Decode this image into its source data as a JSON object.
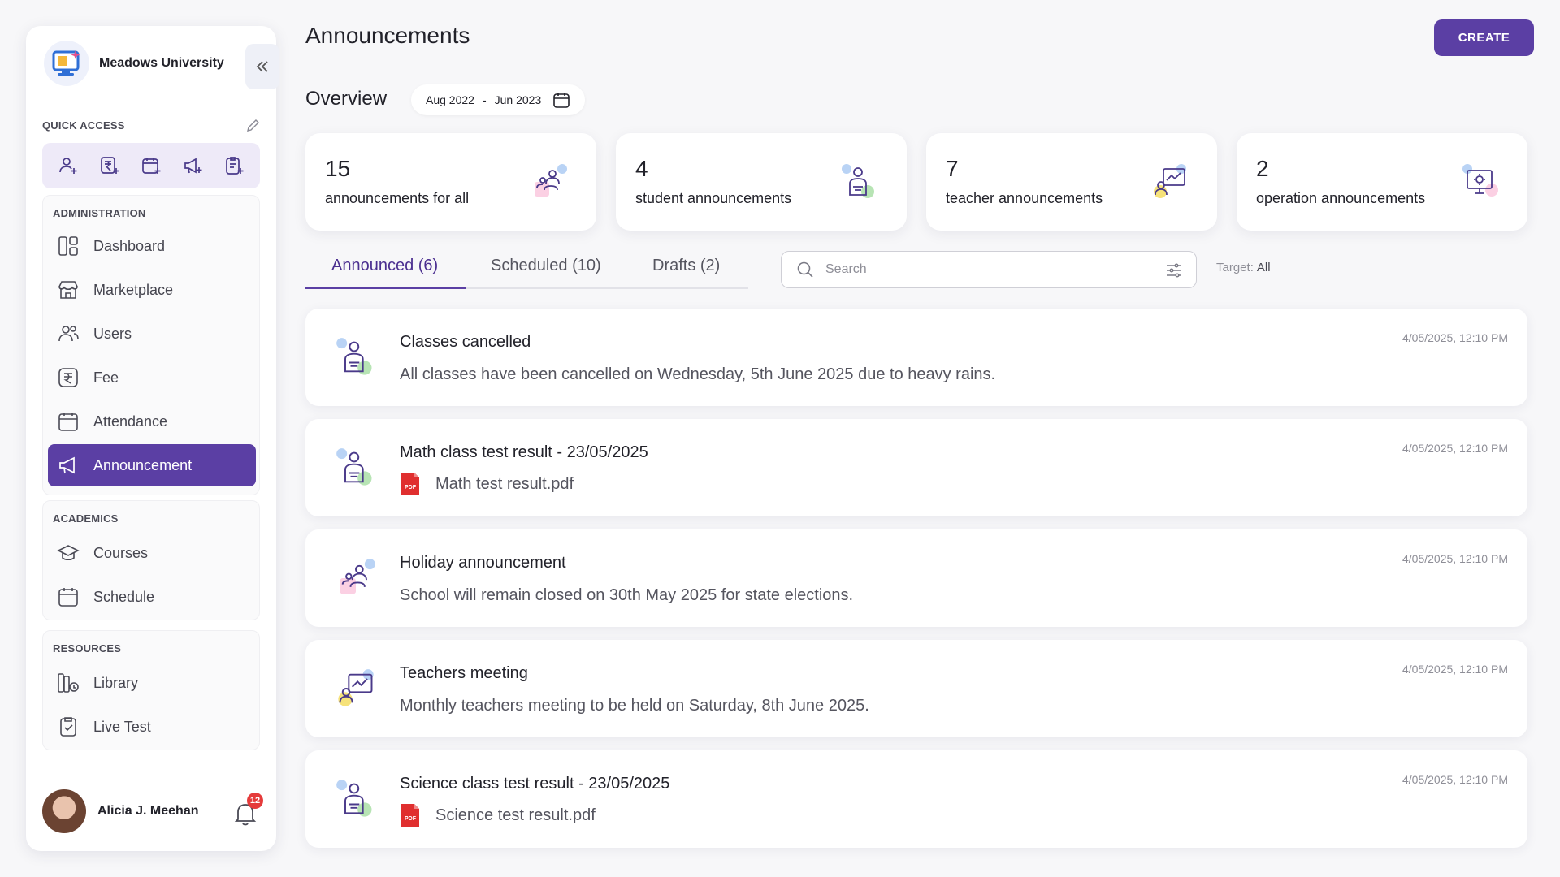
{
  "brand": {
    "name": "Meadows University"
  },
  "quick_access": {
    "label": "QUICK ACCESS"
  },
  "sections": {
    "administration": {
      "label": "ADMINISTRATION",
      "items": [
        {
          "label": "Dashboard",
          "icon": "dashboard-icon"
        },
        {
          "label": "Marketplace",
          "icon": "store-icon"
        },
        {
          "label": "Users",
          "icon": "users-icon"
        },
        {
          "label": "Fee",
          "icon": "rupee-icon"
        },
        {
          "label": "Attendance",
          "icon": "calendar-check-icon"
        },
        {
          "label": "Announcement",
          "icon": "megaphone-icon",
          "active": true
        }
      ]
    },
    "academics": {
      "label": "ACADEMICS",
      "items": [
        {
          "label": "Courses",
          "icon": "graduation-cap-icon"
        },
        {
          "label": "Schedule",
          "icon": "calendar-icon"
        }
      ]
    },
    "resources": {
      "label": "RESOURCES",
      "items": [
        {
          "label": "Library",
          "icon": "books-icon"
        },
        {
          "label": "Live Test",
          "icon": "clipboard-check-icon"
        }
      ]
    }
  },
  "user": {
    "name": "Alicia J. Meehan",
    "notifications": "12"
  },
  "header": {
    "title": "Announcements",
    "create_label": "CREATE"
  },
  "overview": {
    "label": "Overview",
    "date_from": "Aug 2022",
    "date_sep": "-",
    "date_to": "Jun 2023"
  },
  "stats": [
    {
      "value": "15",
      "label": "announcements for all"
    },
    {
      "value": "4",
      "label": "student announcements"
    },
    {
      "value": "7",
      "label": "teacher announcements"
    },
    {
      "value": "2",
      "label": "operation announcements"
    }
  ],
  "tabs": [
    {
      "label": "Announced (6)",
      "active": true
    },
    {
      "label": "Scheduled (10)"
    },
    {
      "label": "Drafts (2)"
    }
  ],
  "search": {
    "placeholder": "Search"
  },
  "target": {
    "label": "Target:",
    "value": "All"
  },
  "announcements": [
    {
      "title": "Classes cancelled",
      "body": "All classes have been cancelled on Wednesday, 5th June 2025 due to heavy rains.",
      "time": "4/05/2025, 12:10 PM",
      "audience": "student"
    },
    {
      "title": "Math class test result - 23/05/2025",
      "attachment": "Math test result.pdf",
      "attachment_badge": "PDF",
      "time": "4/05/2025, 12:10 PM",
      "audience": "student"
    },
    {
      "title": "Holiday announcement",
      "body": "School will remain closed on 30th May 2025 for state elections.",
      "time": "4/05/2025, 12:10 PM",
      "audience": "all"
    },
    {
      "title": "Teachers meeting",
      "body": "Monthly teachers meeting to be held on Saturday, 8th June 2025.",
      "time": "4/05/2025, 12:10 PM",
      "audience": "teacher"
    },
    {
      "title": "Science class test result - 23/05/2025",
      "attachment": "Science test result.pdf",
      "attachment_badge": "PDF",
      "time": "4/05/2025, 12:10 PM",
      "audience": "student"
    }
  ],
  "colors": {
    "accent": "#5b3fa4",
    "badge": "#e53b3b",
    "pdf": "#e02f2f"
  }
}
